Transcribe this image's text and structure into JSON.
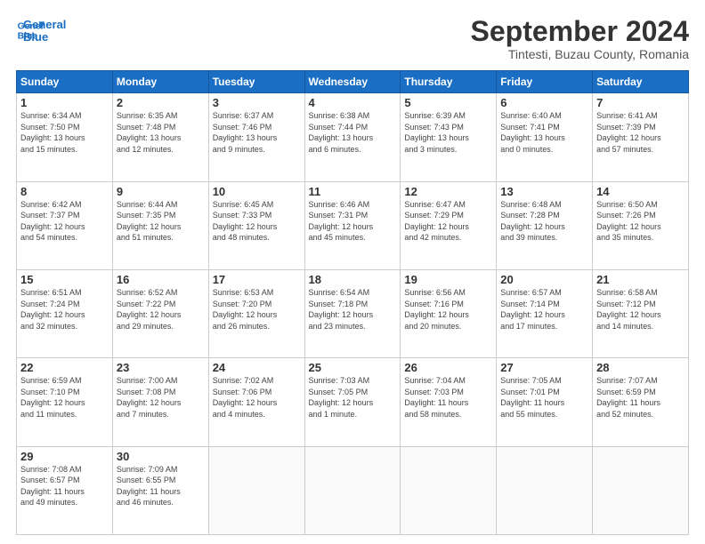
{
  "logo": {
    "line1": "General",
    "line2": "Blue"
  },
  "title": "September 2024",
  "subtitle": "Tintesti, Buzau County, Romania",
  "headers": [
    "Sunday",
    "Monday",
    "Tuesday",
    "Wednesday",
    "Thursday",
    "Friday",
    "Saturday"
  ],
  "weeks": [
    [
      {
        "day": "1",
        "info": "Sunrise: 6:34 AM\nSunset: 7:50 PM\nDaylight: 13 hours\nand 15 minutes."
      },
      {
        "day": "2",
        "info": "Sunrise: 6:35 AM\nSunset: 7:48 PM\nDaylight: 13 hours\nand 12 minutes."
      },
      {
        "day": "3",
        "info": "Sunrise: 6:37 AM\nSunset: 7:46 PM\nDaylight: 13 hours\nand 9 minutes."
      },
      {
        "day": "4",
        "info": "Sunrise: 6:38 AM\nSunset: 7:44 PM\nDaylight: 13 hours\nand 6 minutes."
      },
      {
        "day": "5",
        "info": "Sunrise: 6:39 AM\nSunset: 7:43 PM\nDaylight: 13 hours\nand 3 minutes."
      },
      {
        "day": "6",
        "info": "Sunrise: 6:40 AM\nSunset: 7:41 PM\nDaylight: 13 hours\nand 0 minutes."
      },
      {
        "day": "7",
        "info": "Sunrise: 6:41 AM\nSunset: 7:39 PM\nDaylight: 12 hours\nand 57 minutes."
      }
    ],
    [
      {
        "day": "8",
        "info": "Sunrise: 6:42 AM\nSunset: 7:37 PM\nDaylight: 12 hours\nand 54 minutes."
      },
      {
        "day": "9",
        "info": "Sunrise: 6:44 AM\nSunset: 7:35 PM\nDaylight: 12 hours\nand 51 minutes."
      },
      {
        "day": "10",
        "info": "Sunrise: 6:45 AM\nSunset: 7:33 PM\nDaylight: 12 hours\nand 48 minutes."
      },
      {
        "day": "11",
        "info": "Sunrise: 6:46 AM\nSunset: 7:31 PM\nDaylight: 12 hours\nand 45 minutes."
      },
      {
        "day": "12",
        "info": "Sunrise: 6:47 AM\nSunset: 7:29 PM\nDaylight: 12 hours\nand 42 minutes."
      },
      {
        "day": "13",
        "info": "Sunrise: 6:48 AM\nSunset: 7:28 PM\nDaylight: 12 hours\nand 39 minutes."
      },
      {
        "day": "14",
        "info": "Sunrise: 6:50 AM\nSunset: 7:26 PM\nDaylight: 12 hours\nand 35 minutes."
      }
    ],
    [
      {
        "day": "15",
        "info": "Sunrise: 6:51 AM\nSunset: 7:24 PM\nDaylight: 12 hours\nand 32 minutes."
      },
      {
        "day": "16",
        "info": "Sunrise: 6:52 AM\nSunset: 7:22 PM\nDaylight: 12 hours\nand 29 minutes."
      },
      {
        "day": "17",
        "info": "Sunrise: 6:53 AM\nSunset: 7:20 PM\nDaylight: 12 hours\nand 26 minutes."
      },
      {
        "day": "18",
        "info": "Sunrise: 6:54 AM\nSunset: 7:18 PM\nDaylight: 12 hours\nand 23 minutes."
      },
      {
        "day": "19",
        "info": "Sunrise: 6:56 AM\nSunset: 7:16 PM\nDaylight: 12 hours\nand 20 minutes."
      },
      {
        "day": "20",
        "info": "Sunrise: 6:57 AM\nSunset: 7:14 PM\nDaylight: 12 hours\nand 17 minutes."
      },
      {
        "day": "21",
        "info": "Sunrise: 6:58 AM\nSunset: 7:12 PM\nDaylight: 12 hours\nand 14 minutes."
      }
    ],
    [
      {
        "day": "22",
        "info": "Sunrise: 6:59 AM\nSunset: 7:10 PM\nDaylight: 12 hours\nand 11 minutes."
      },
      {
        "day": "23",
        "info": "Sunrise: 7:00 AM\nSunset: 7:08 PM\nDaylight: 12 hours\nand 7 minutes."
      },
      {
        "day": "24",
        "info": "Sunrise: 7:02 AM\nSunset: 7:06 PM\nDaylight: 12 hours\nand 4 minutes."
      },
      {
        "day": "25",
        "info": "Sunrise: 7:03 AM\nSunset: 7:05 PM\nDaylight: 12 hours\nand 1 minute."
      },
      {
        "day": "26",
        "info": "Sunrise: 7:04 AM\nSunset: 7:03 PM\nDaylight: 11 hours\nand 58 minutes."
      },
      {
        "day": "27",
        "info": "Sunrise: 7:05 AM\nSunset: 7:01 PM\nDaylight: 11 hours\nand 55 minutes."
      },
      {
        "day": "28",
        "info": "Sunrise: 7:07 AM\nSunset: 6:59 PM\nDaylight: 11 hours\nand 52 minutes."
      }
    ],
    [
      {
        "day": "29",
        "info": "Sunrise: 7:08 AM\nSunset: 6:57 PM\nDaylight: 11 hours\nand 49 minutes."
      },
      {
        "day": "30",
        "info": "Sunrise: 7:09 AM\nSunset: 6:55 PM\nDaylight: 11 hours\nand 46 minutes."
      },
      {
        "day": "",
        "info": ""
      },
      {
        "day": "",
        "info": ""
      },
      {
        "day": "",
        "info": ""
      },
      {
        "day": "",
        "info": ""
      },
      {
        "day": "",
        "info": ""
      }
    ]
  ]
}
